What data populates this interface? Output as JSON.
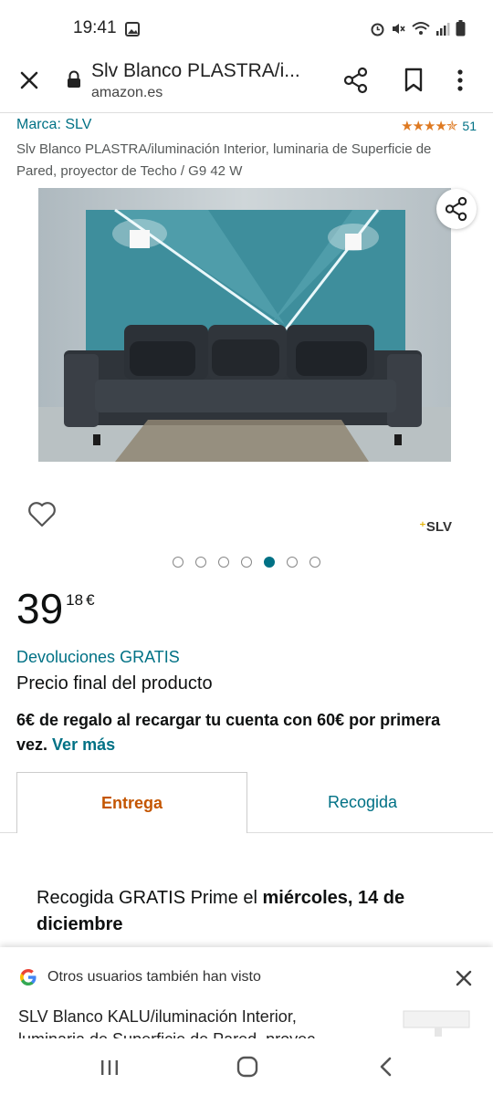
{
  "status_bar": {
    "time": "19:41",
    "icons": [
      "image-icon",
      "alarm-icon",
      "mute-icon",
      "wifi-icon",
      "signal-icon",
      "battery-icon"
    ]
  },
  "browser": {
    "page_title": "Slv Blanco PLASTRA/i...",
    "domain": "amazon.es",
    "icons": [
      "close-icon",
      "lock-icon",
      "share-icon",
      "bookmark-icon",
      "more-vertical-icon"
    ]
  },
  "product": {
    "brand": "Marca: SLV",
    "rating_stars": 4.5,
    "rating_count": "51",
    "title": "Slv Blanco PLASTRA/iluminación Interior, luminaria de Superficie de Pared, proyector de Techo / G9 42 W",
    "brand_logo": "SLV",
    "gallery_dots_total": 7,
    "gallery_active_index": 4
  },
  "price": {
    "whole": "39",
    "fraction": "18",
    "currency": "€"
  },
  "offers": {
    "returns": "Devoluciones GRATIS",
    "final_price": "Precio final del producto",
    "gift_text": "6€ de regalo al recargar tu cuenta con 60€ por primera vez.",
    "gift_link": "Ver más"
  },
  "tabs": [
    {
      "label": "Entrega",
      "active": true
    },
    {
      "label": "Recogida",
      "active": false
    }
  ],
  "pickup": {
    "prefix": "Recogida GRATIS Prime el ",
    "date": "miércoles, 14 de diciembre"
  },
  "bottom_sheet": {
    "header": "Otros usuarios también han visto",
    "item_title": "SLV Blanco KALU/iluminación Interior, luminaria de Superficie de Pared, proyec..."
  },
  "colors": {
    "link": "#007185",
    "active_tab": "#c45500",
    "stars": "#de7921",
    "wall_panel": "#3e8e9c"
  }
}
